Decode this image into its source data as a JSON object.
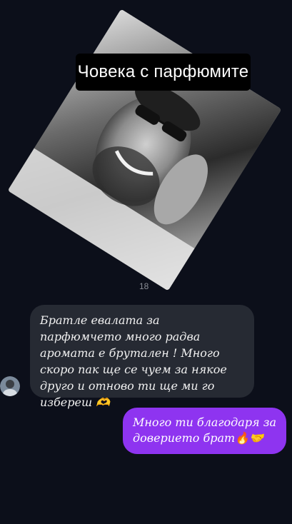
{
  "story": {
    "caption": "Човека с парфюмите",
    "counter": "18"
  },
  "messages": [
    {
      "direction": "incoming",
      "text": "Братле евалата за парфюмчето много радва аромата е брутален ! Много скоро пак ще се чуем за някое друго и отново ти ще ми го избереш 🫶"
    },
    {
      "direction": "outgoing",
      "text": "Много ти благодаря за доверието брат🔥🤝"
    }
  ],
  "colors": {
    "background": "#0c0f1a",
    "incoming_bubble": "#262a33",
    "outgoing_bubble": "#8e34f0"
  }
}
